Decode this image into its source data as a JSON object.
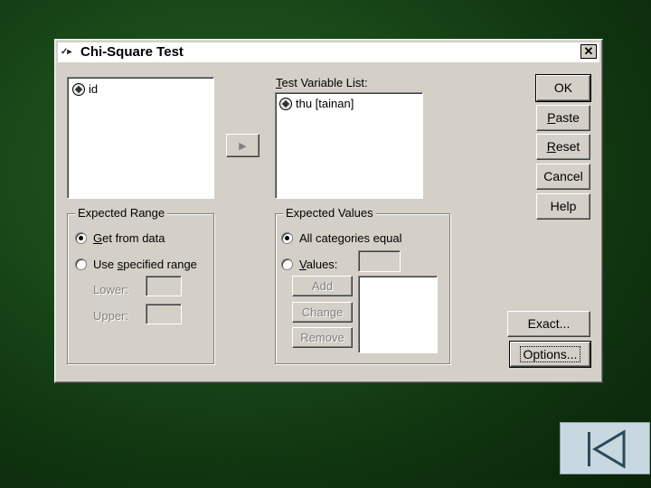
{
  "dialog": {
    "title": "Chi-Square Test",
    "close_glyph": "✕",
    "source_variables": [
      {
        "label": "id",
        "icon": "scale-variable-icon"
      }
    ],
    "test_variable_list_label": "Test Variable List:",
    "test_variables": [
      {
        "label": "thu [tainan]",
        "icon": "scale-variable-icon"
      }
    ],
    "move_arrow": "▶",
    "buttons": {
      "ok": "OK",
      "paste": "Paste",
      "reset": "Reset",
      "cancel": "Cancel",
      "help": "Help",
      "exact": "Exact...",
      "options": "Options..."
    },
    "expected_range": {
      "title": "Expected Range",
      "get_from_data": "Get from data",
      "use_specified_range": "Use specified range",
      "lower": "Lower:",
      "upper": "Upper:",
      "selected": "get_from_data"
    },
    "expected_values": {
      "title": "Expected Values",
      "all_categories_equal": "All categories equal",
      "values": "Values:",
      "add": "Add",
      "change": "Change",
      "remove": "Remove",
      "selected": "all_categories_equal"
    }
  },
  "colors": {
    "background": "#1a4a1a",
    "dialog_face": "#d4d0c8",
    "nav_widget": "#c8d8e0"
  }
}
